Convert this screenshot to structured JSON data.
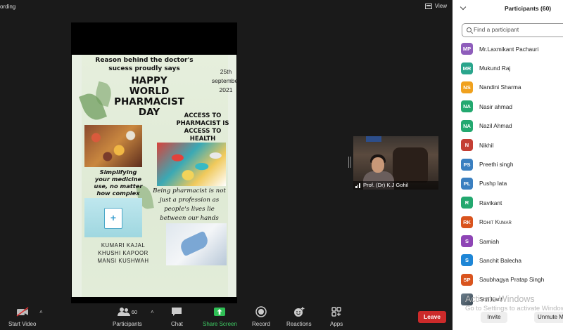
{
  "meeting": {
    "recording_label": "ording",
    "view_label": "View"
  },
  "poster": {
    "heading": "Reason behind the doctor's sucess proudly says",
    "date_line1": "25th",
    "date_line2": "september",
    "date_line3": "2021",
    "happy_line1": "HAPPY",
    "happy_line2": "WORLD",
    "happy_line3": "PHARMACIST",
    "happy_line4": "DAY",
    "access_line1": "ACCESS TO",
    "access_line2": "PHARMACIST IS",
    "access_line3": "ACCESS TO",
    "access_line4": "HEALTH",
    "simplify_line1": "Simplifying",
    "simplify_line2": "your medicine",
    "simplify_line3": "use, no matter",
    "simplify_line4": "how complex",
    "being_line1": "Being pharmacist is not",
    "being_line2": "just a profession as",
    "being_line3": "people's lives lie",
    "being_line4": "between our hands",
    "name1": "KUMARI KAJAL",
    "name2": "KHUSHI KAPOOR",
    "name3": "MANSI KUSHWAH"
  },
  "video": {
    "participant_name": "Prof. (Dr) K.J Gohil"
  },
  "toolbar": {
    "start_video": "Start Video",
    "participants": "Participants",
    "participants_count": "60",
    "chat": "Chat",
    "share_screen": "Share Screen",
    "record": "Record",
    "reactions": "Reactions",
    "apps": "Apps",
    "leave": "Leave"
  },
  "panel": {
    "title": "Participants (60)",
    "search_placeholder": "Find a participant",
    "participants": [
      {
        "initials": "MP",
        "name": "Mr.Laxmikant Pachauri",
        "color": "#8e5dbb"
      },
      {
        "initials": "MR",
        "name": "Mukund Raj",
        "color": "#2aa58c"
      },
      {
        "initials": "NS",
        "name": "Nandini Sharma",
        "color": "#f0a11e"
      },
      {
        "initials": "NA",
        "name": "Nasir ahmad",
        "color": "#23a86f"
      },
      {
        "initials": "NA",
        "name": "Nazil Ahmad",
        "color": "#23a86f"
      },
      {
        "initials": "N",
        "name": "Nikhil",
        "color": "#c43e33"
      },
      {
        "initials": "PS",
        "name": "Preethi singh",
        "color": "#3a7fc0"
      },
      {
        "initials": "PL",
        "name": "Pushp lata",
        "color": "#3a7fc0"
      },
      {
        "initials": "R",
        "name": "Ravikant",
        "color": "#23a86f"
      },
      {
        "initials": "RK",
        "name": "Rohit Kumar",
        "color": "#d9541e"
      },
      {
        "initials": "S",
        "name": "Samiah",
        "color": "#8e45b5"
      },
      {
        "initials": "S",
        "name": "Sanchit Balecha",
        "color": "#1e86d6"
      },
      {
        "initials": "SP",
        "name": "Saubhagya Pratap Singh",
        "color": "#d9541e"
      }
    ],
    "last_participant": "Shri Kant",
    "watermark_line1": "Activate Windows",
    "watermark_line2": "Go to Settings to activate Windows.",
    "invite_label": "Invite",
    "unmute_label": "Unmute Me"
  }
}
